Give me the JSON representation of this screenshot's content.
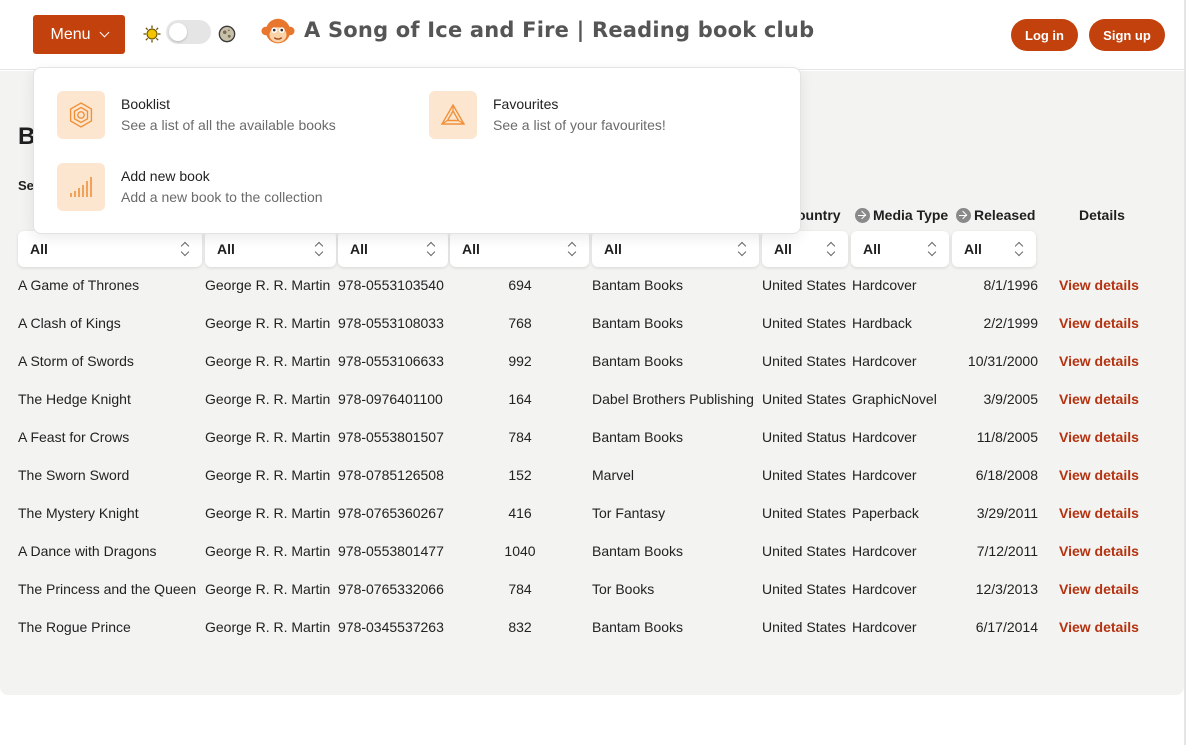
{
  "header": {
    "menu_label": "Menu",
    "site_title": "A Song of Ice and Fire | Reading book club",
    "login_label": "Log in",
    "signup_label": "Sign up",
    "brand_color": "#c2410c",
    "icons": {
      "theme_light": "sun-icon",
      "theme_dark": "moon-icon",
      "logo": "monkey-logo-icon"
    }
  },
  "dropdown": {
    "items": [
      {
        "title": "Booklist",
        "desc": "See a list of all the available books",
        "icon": "hexagon-icon"
      },
      {
        "title": "Favourites",
        "desc": "See a list of your favourites!",
        "icon": "triangle-icon"
      },
      {
        "title": "Add new book",
        "desc": "Add a new book to the collection",
        "icon": "bars-icon"
      }
    ]
  },
  "page": {
    "heading": "B",
    "search_label": "Se"
  },
  "table": {
    "headers": {
      "country": "ountry",
      "media_type": "Media Type",
      "released": "Released",
      "details": "Details"
    },
    "filters": [
      "All",
      "All",
      "All",
      "All",
      "All",
      "All",
      "All",
      "All"
    ],
    "details_label": "View details",
    "rows": [
      {
        "name": "A Game of Thrones",
        "author": "George R. R. Martin",
        "isbn": "978-0553103540",
        "pages": "694",
        "publisher": "Bantam Books",
        "country": "United States",
        "media": "Hardcover",
        "released": "8/1/1996"
      },
      {
        "name": "A Clash of Kings",
        "author": "George R. R. Martin",
        "isbn": "978-0553108033",
        "pages": "768",
        "publisher": "Bantam Books",
        "country": "United States",
        "media": "Hardback",
        "released": "2/2/1999"
      },
      {
        "name": "A Storm of Swords",
        "author": "George R. R. Martin",
        "isbn": "978-0553106633",
        "pages": "992",
        "publisher": "Bantam Books",
        "country": "United States",
        "media": "Hardcover",
        "released": "10/31/2000"
      },
      {
        "name": "The Hedge Knight",
        "author": "George R. R. Martin",
        "isbn": "978-0976401100",
        "pages": "164",
        "publisher": "Dabel Brothers Publishing",
        "country": "United States",
        "media": "GraphicNovel",
        "released": "3/9/2005"
      },
      {
        "name": "A Feast for Crows",
        "author": "George R. R. Martin",
        "isbn": "978-0553801507",
        "pages": "784",
        "publisher": "Bantam Books",
        "country": "United Status",
        "media": "Hardcover",
        "released": "11/8/2005"
      },
      {
        "name": "The Sworn Sword",
        "author": "George R. R. Martin",
        "isbn": "978-0785126508",
        "pages": "152",
        "publisher": "Marvel",
        "country": "United States",
        "media": "Hardcover",
        "released": "6/18/2008"
      },
      {
        "name": "The Mystery Knight",
        "author": "George R. R. Martin",
        "isbn": "978-0765360267",
        "pages": "416",
        "publisher": "Tor Fantasy",
        "country": "United States",
        "media": "Paperback",
        "released": "3/29/2011"
      },
      {
        "name": "A Dance with Dragons",
        "author": "George R. R. Martin",
        "isbn": "978-0553801477",
        "pages": "1040",
        "publisher": "Bantam Books",
        "country": "United States",
        "media": "Hardcover",
        "released": "7/12/2011"
      },
      {
        "name": "The Princess and the Queen",
        "author": "George R. R. Martin",
        "isbn": "978-0765332066",
        "pages": "784",
        "publisher": "Tor Books",
        "country": "United States",
        "media": "Hardcover",
        "released": "12/3/2013"
      },
      {
        "name": "The Rogue Prince",
        "author": "George R. R. Martin",
        "isbn": "978-0345537263",
        "pages": "832",
        "publisher": "Bantam Books",
        "country": "United States",
        "media": "Hardcover",
        "released": "6/17/2014"
      }
    ]
  }
}
